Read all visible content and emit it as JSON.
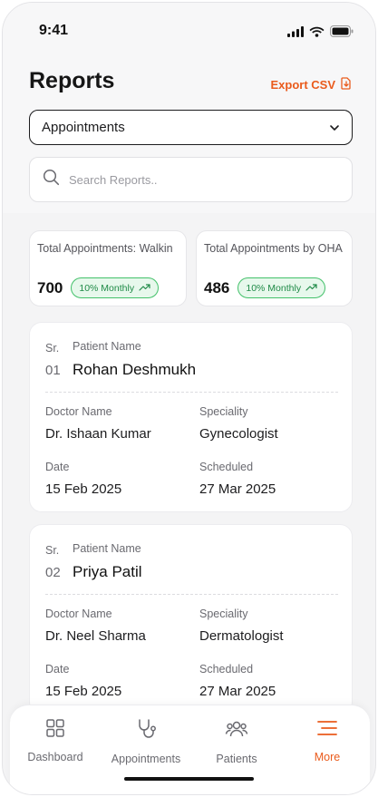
{
  "status_bar": {
    "time": "9:41"
  },
  "header": {
    "title": "Reports",
    "export_label": "Export CSV"
  },
  "report_select": {
    "value": "Appointments"
  },
  "search": {
    "placeholder": "Search Reports.."
  },
  "stats": [
    {
      "label": "Total Appointments: Walkin",
      "value": "700",
      "badge": "10% Monthly"
    },
    {
      "label": "Total Appointments by OHA",
      "value": "486",
      "badge": "10% Monthly"
    }
  ],
  "card_labels": {
    "sr": "Sr.",
    "patient_name": "Patient Name",
    "doctor_name": "Doctor Name",
    "speciality": "Speciality",
    "date": "Date",
    "scheduled": "Scheduled"
  },
  "records": [
    {
      "sr": "01",
      "patient": "Rohan Deshmukh",
      "doctor": "Dr. Ishaan Kumar",
      "speciality": "Gynecologist",
      "date": "15 Feb 2025",
      "scheduled": "27 Mar 2025"
    },
    {
      "sr": "02",
      "patient": "Priya Patil",
      "doctor": "Dr. Neel Sharma",
      "speciality": "Dermatologist",
      "date": "15 Feb 2025",
      "scheduled": "27 Mar 2025"
    }
  ],
  "tabs": [
    {
      "label": "Dashboard",
      "icon": "grid-icon"
    },
    {
      "label": "Appointments",
      "icon": "stethoscope-icon"
    },
    {
      "label": "Patients",
      "icon": "users-icon"
    },
    {
      "label": "More",
      "icon": "menu-icon",
      "active": true
    }
  ],
  "colors": {
    "accent": "#ea5b1c",
    "badge_green": "#1f8a47",
    "badge_bg": "#e7f8ec"
  }
}
